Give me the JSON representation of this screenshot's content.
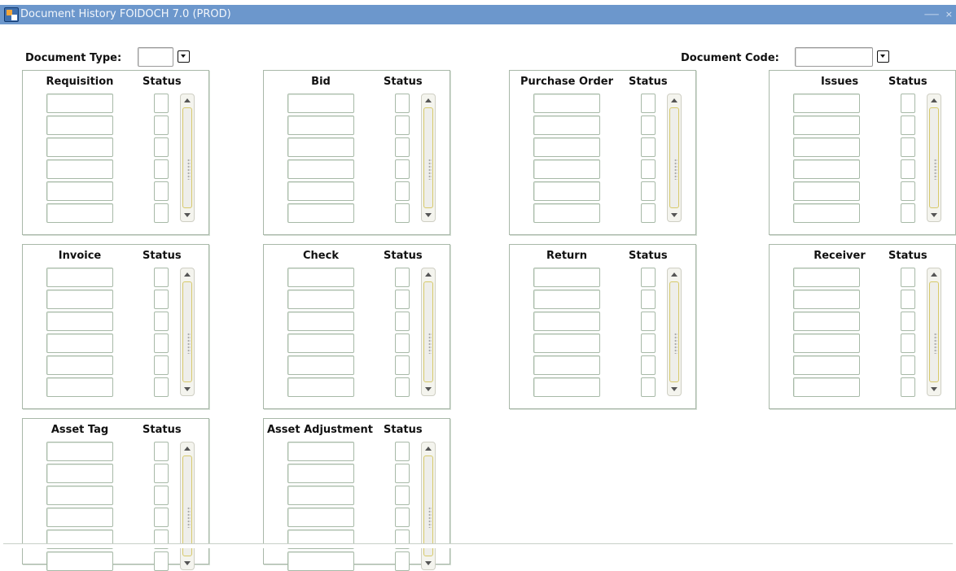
{
  "window": {
    "title": "Document History  FOIDOCH  7.0  (PROD)",
    "controls": "⸺ ×"
  },
  "header": {
    "document_type_label": "Document Type:",
    "document_code_label": "Document Code:",
    "document_type_value": "",
    "document_code_value": ""
  },
  "status_label": "Status",
  "panels": [
    {
      "title": "Requisition"
    },
    {
      "title": "Bid"
    },
    {
      "title": "Purchase Order"
    },
    {
      "title": "Issues"
    },
    {
      "title": "Invoice"
    },
    {
      "title": "Check"
    },
    {
      "title": "Return"
    },
    {
      "title": "Receiver"
    },
    {
      "title": "Asset Tag"
    },
    {
      "title": "Asset Adjustment"
    }
  ],
  "colors": {
    "titlebar": "#6c97cc",
    "panel_border": "#a9b8a9",
    "scroll_accent": "#d7c96a"
  }
}
